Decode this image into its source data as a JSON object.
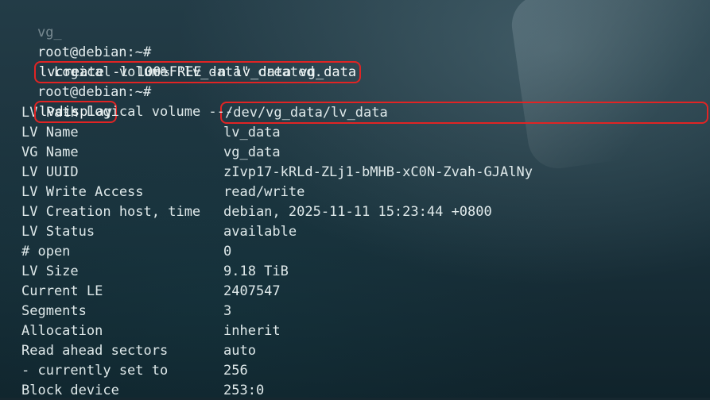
{
  "terminal": {
    "partial_top": "vg_",
    "prompt": "root@debian:~#",
    "commands": {
      "create": "lvcreate -l 100%FREE -n lv_data vg_data",
      "display": "lvdisplay"
    },
    "messages": {
      "created": "Logical volume \"lv_data\" created.",
      "section_title": "--- Logical volume ---"
    },
    "fields": [
      {
        "label": "LV Path",
        "value": "/dev/vg_data/lv_data"
      },
      {
        "label": "LV Name",
        "value": "lv_data"
      },
      {
        "label": "VG Name",
        "value": "vg_data"
      },
      {
        "label": "LV UUID",
        "value": "zIvp17-kRLd-ZLj1-bMHB-xC0N-Zvah-GJAlNy"
      },
      {
        "label": "LV Write Access",
        "value": "read/write"
      },
      {
        "label": "LV Creation host, time",
        "value": "debian, 2025-11-11 15:23:44 +0800"
      },
      {
        "label": "LV Status",
        "value": "available"
      },
      {
        "label": "# open",
        "value": "0"
      },
      {
        "label": "LV Size",
        "value": "9.18 TiB"
      },
      {
        "label": "Current LE",
        "value": "2407547"
      },
      {
        "label": "Segments",
        "value": "3"
      },
      {
        "label": "Allocation",
        "value": "inherit"
      },
      {
        "label": "Read ahead sectors",
        "value": "auto"
      },
      {
        "label": "- currently set to",
        "value": "256"
      },
      {
        "label": "Block device",
        "value": "253:0"
      }
    ]
  },
  "colors": {
    "highlight": "#e12424",
    "text": "#dfe9ea",
    "background": "#1a313b"
  }
}
